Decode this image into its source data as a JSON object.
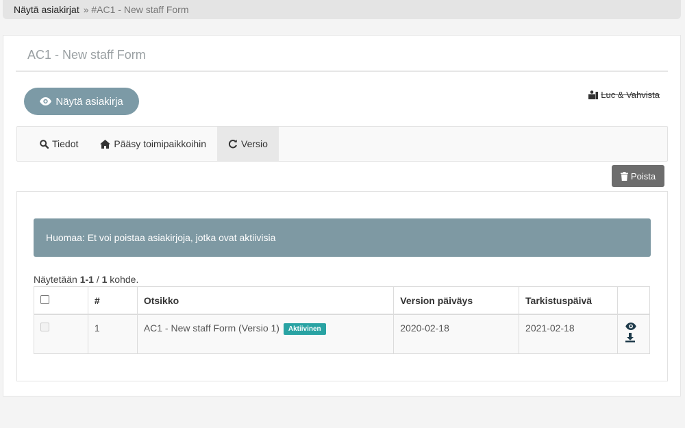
{
  "breadcrumb": {
    "parent": "Näytä asiakirjat",
    "current": "» #AC1 - New staff Form"
  },
  "page": {
    "title": "AC1 - New staff Form"
  },
  "actions": {
    "view_document": "Näytä asiakirja",
    "read_confirm": "Luc & Vahvista",
    "delete": "Poista"
  },
  "tabs": [
    {
      "label": "Tiedot",
      "icon": "search-icon"
    },
    {
      "label": "Pääsy toimipaikkoihin",
      "icon": "home-icon"
    },
    {
      "label": "Versio",
      "icon": "refresh-icon",
      "active": true
    }
  ],
  "notice": "Huomaa: Et voi poistaa asiakirjoja, jotka ovat aktiivisia",
  "summary": {
    "prefix": "Näytetään ",
    "range": "1-1",
    "sep": " / ",
    "total": "1",
    "suffix": " kohde."
  },
  "table": {
    "headers": [
      "#",
      "Otsikko",
      "Version päiväys",
      "Tarkistuspäivä"
    ],
    "rows": [
      {
        "num": "1",
        "title": "AC1 - New staff Form (Versio 1)",
        "badge": "Aktiivinen",
        "version_date": "2020-02-18",
        "review_date": "2021-02-18"
      }
    ]
  },
  "colors": {
    "accent": "#7c9aa6",
    "notice_bg": "#7e99a3",
    "badge": "#29a3a3",
    "delete_btn": "#6d6d6d"
  }
}
